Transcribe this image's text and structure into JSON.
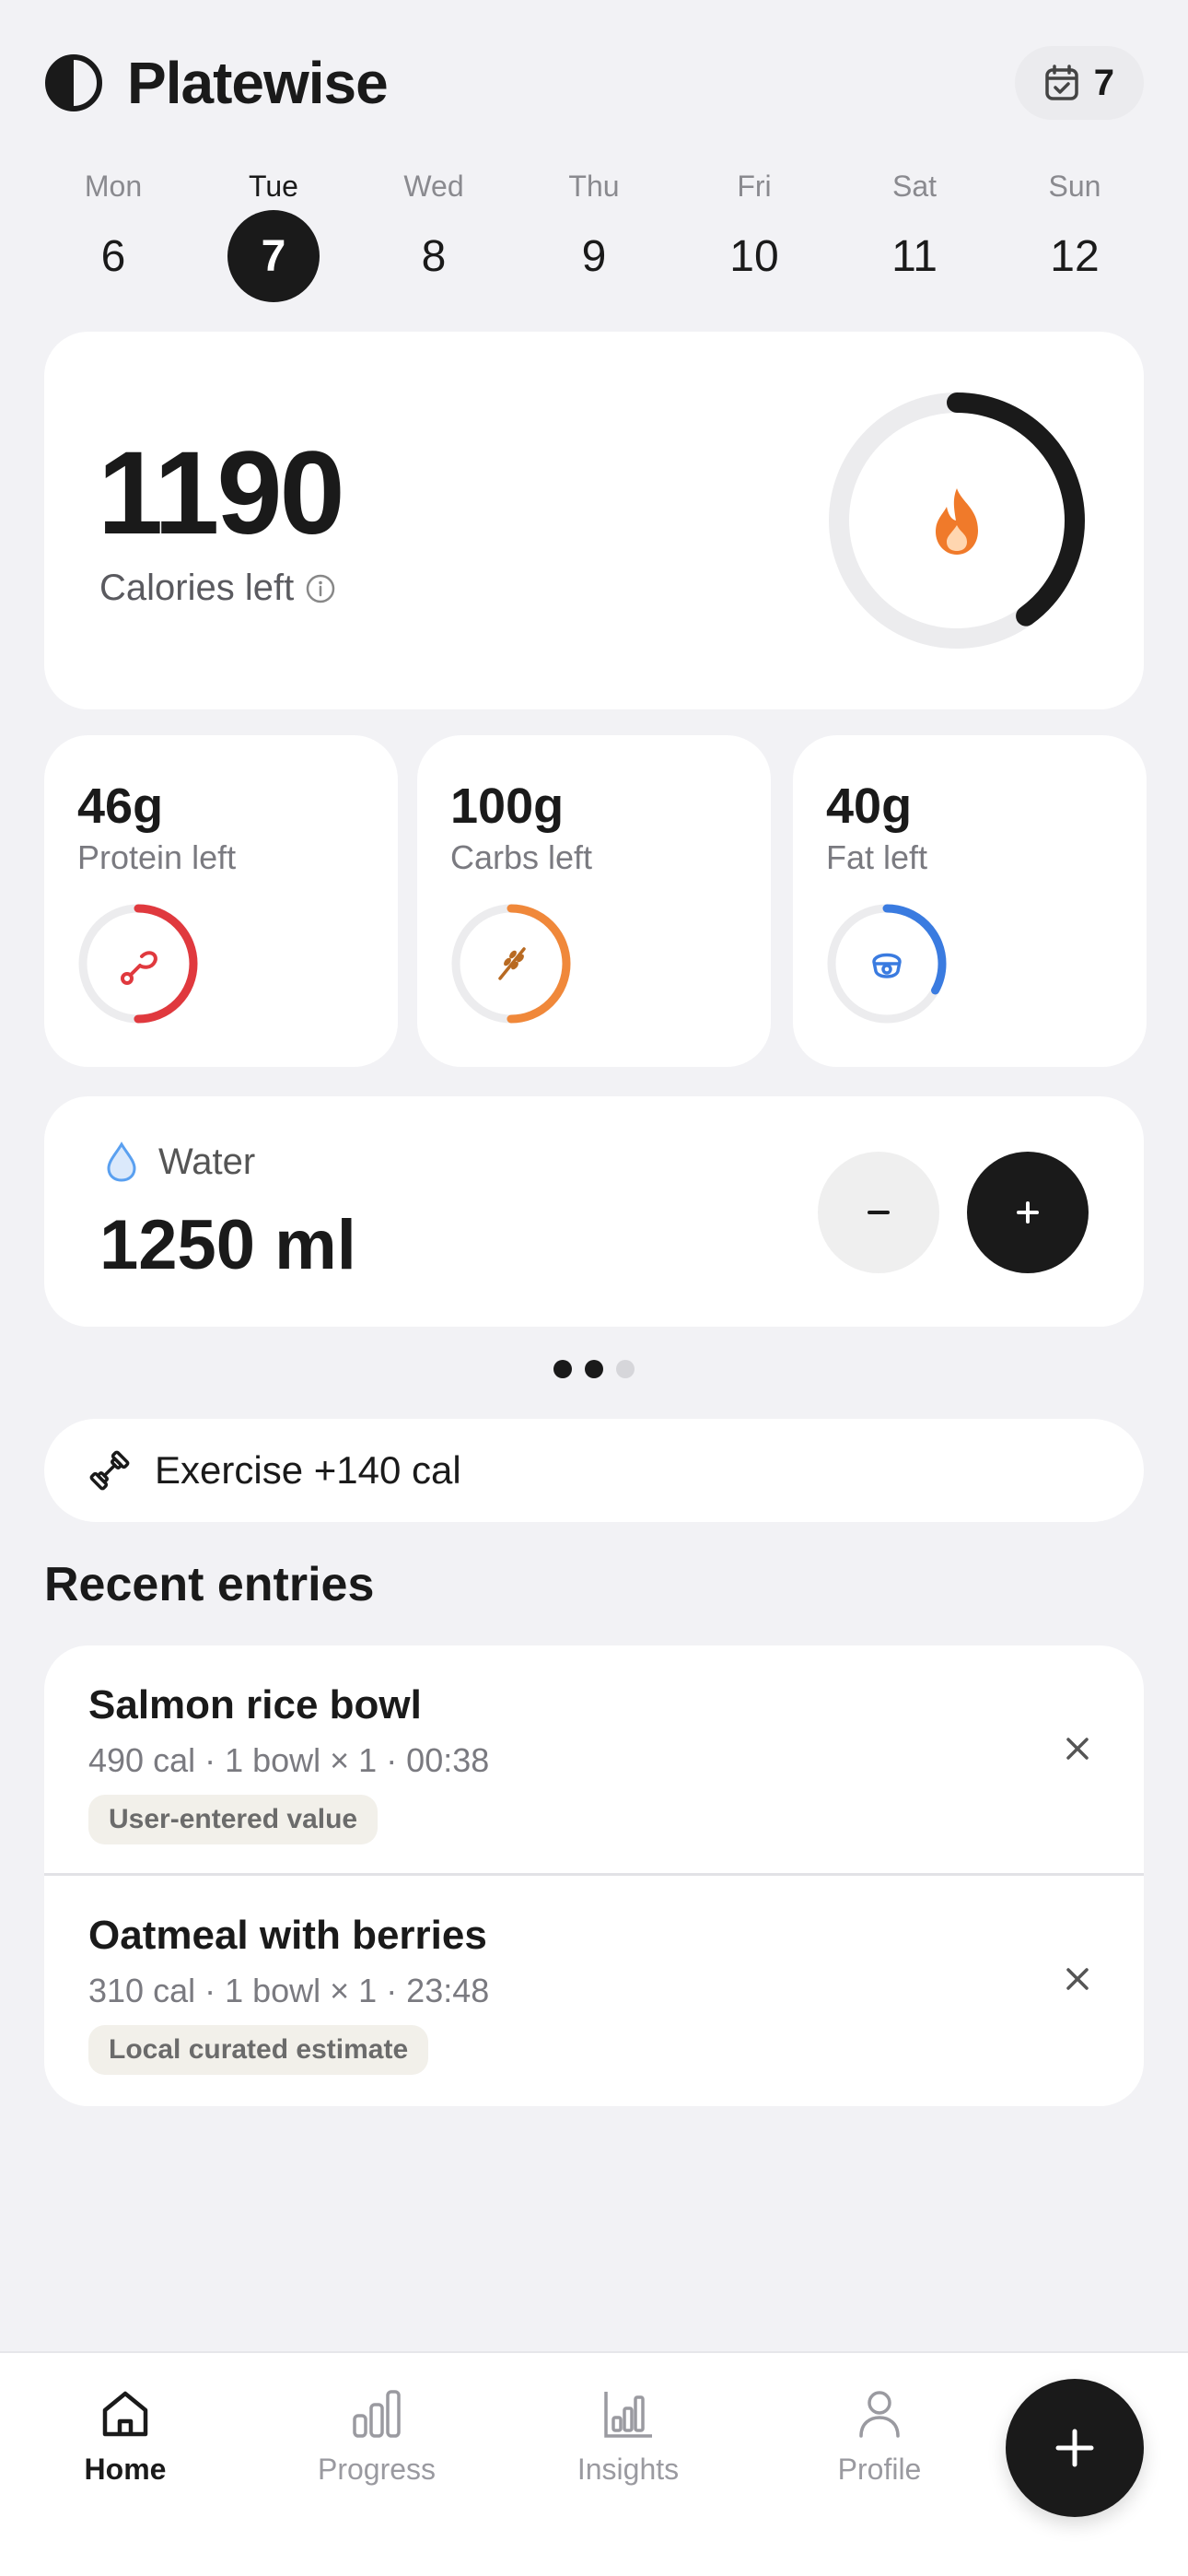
{
  "app": {
    "name": "Platewise"
  },
  "streak": {
    "count": "7"
  },
  "week": [
    {
      "name": "Mon",
      "num": "6",
      "active": false
    },
    {
      "name": "Tue",
      "num": "7",
      "active": true
    },
    {
      "name": "Wed",
      "num": "8",
      "active": false
    },
    {
      "name": "Thu",
      "num": "9",
      "active": false
    },
    {
      "name": "Fri",
      "num": "10",
      "active": false
    },
    {
      "name": "Sat",
      "num": "11",
      "active": false
    },
    {
      "name": "Sun",
      "num": "12",
      "active": false
    }
  ],
  "calories": {
    "value": "1190",
    "label": "Calories left",
    "progress": 0.4
  },
  "macros": [
    {
      "value": "46g",
      "label": "Protein left",
      "icon": "drumstick-icon",
      "color": "#e0393e",
      "progress": 0.5
    },
    {
      "value": "100g",
      "label": "Carbs left",
      "icon": "wheat-icon",
      "color": "#f0883a",
      "progress": 0.5
    },
    {
      "value": "40g",
      "label": "Fat left",
      "icon": "avocado-icon",
      "color": "#3a7be0",
      "progress": 0.33
    }
  ],
  "water": {
    "label": "Water",
    "value": "1250 ml"
  },
  "carousel": {
    "pages": 3,
    "active": [
      0,
      1
    ]
  },
  "exercise": {
    "label": "Exercise +140 cal"
  },
  "recent": {
    "title": "Recent entries",
    "entries": [
      {
        "name": "Salmon rice bowl",
        "meta": "490 cal · 1 bowl × 1 · 00:38",
        "tag": "User-entered value"
      },
      {
        "name": "Oatmeal with berries",
        "meta": "310 cal · 1 bowl × 1 · 23:48",
        "tag": "Local curated estimate"
      }
    ]
  },
  "nav": {
    "home": "Home",
    "progress": "Progress",
    "insights": "Insights",
    "profile": "Profile",
    "active": "home"
  },
  "colors": {
    "background": "#f2f2f5",
    "accent": "#1a1a1a",
    "flame": "#f07a2a",
    "water": "#5aa0f0"
  }
}
